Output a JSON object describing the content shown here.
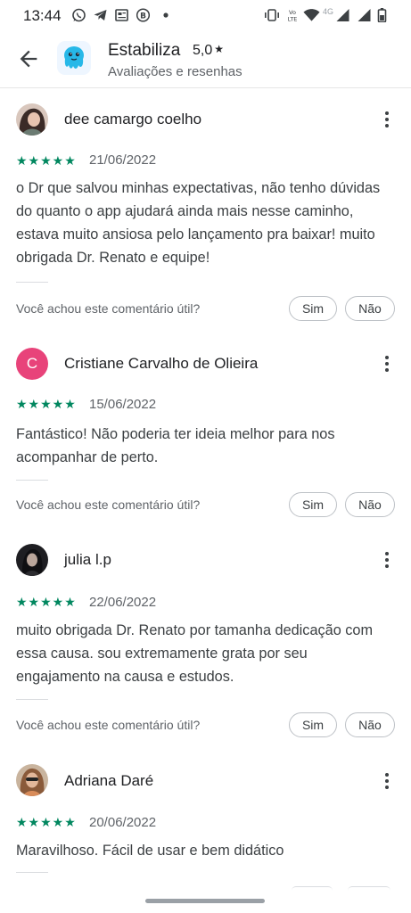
{
  "status_bar": {
    "time": "13:44",
    "left_icons": [
      "whatsapp-icon",
      "telegram-icon",
      "news-icon",
      "bitcoin-icon",
      "dot-icon"
    ],
    "right_icons": [
      "vibrate-icon",
      "volte-icon",
      "wifi-icon",
      "signal-icon",
      "battery-icon"
    ],
    "network_label": "4G"
  },
  "header": {
    "app_name": "Estabiliza",
    "rating": "5,0",
    "star": "★",
    "subtitle": "Avaliações e resenhas"
  },
  "reviews": [
    {
      "name": "dee camargo coelho",
      "avatar_type": "photo",
      "stars": "★★★★★",
      "date": "21/06/2022",
      "text": "o Dr que salvou minhas expectativas, não tenho dúvidas do quanto o app ajudará ainda mais nesse caminho, estava muito ansiosa pelo lançamento pra baixar! muito obrigada Dr. Renato e equipe!",
      "helpful_question": "Você achou este comentário útil?",
      "yes_label": "Sim",
      "no_label": "Não"
    },
    {
      "name": "Cristiane Carvalho de Olieira",
      "avatar_type": "letter",
      "avatar_letter": "C",
      "avatar_color": "#e8437a",
      "stars": "★★★★★",
      "date": "15/06/2022",
      "text": "Fantástico! Não poderia ter ideia melhor para nos acompanhar de perto.",
      "helpful_question": "Você achou este comentário útil?",
      "yes_label": "Sim",
      "no_label": "Não"
    },
    {
      "name": "julia l.p",
      "avatar_type": "photo",
      "stars": "★★★★★",
      "date": "22/06/2022",
      "text": "muito obrigada Dr. Renato por tamanha dedicação com essa causa. sou extremamente grata por seu engajamento na causa e estudos.",
      "helpful_question": "Você achou este comentário útil?",
      "yes_label": "Sim",
      "no_label": "Não"
    },
    {
      "name": "Adriana Daré",
      "avatar_type": "photo",
      "stars": "★★★★★",
      "date": "20/06/2022",
      "text": "Maravilhoso. Fácil de usar e bem didático"
    }
  ],
  "colors": {
    "star_green": "#01875f",
    "text_primary": "#202124",
    "text_secondary": "#5f6368"
  }
}
